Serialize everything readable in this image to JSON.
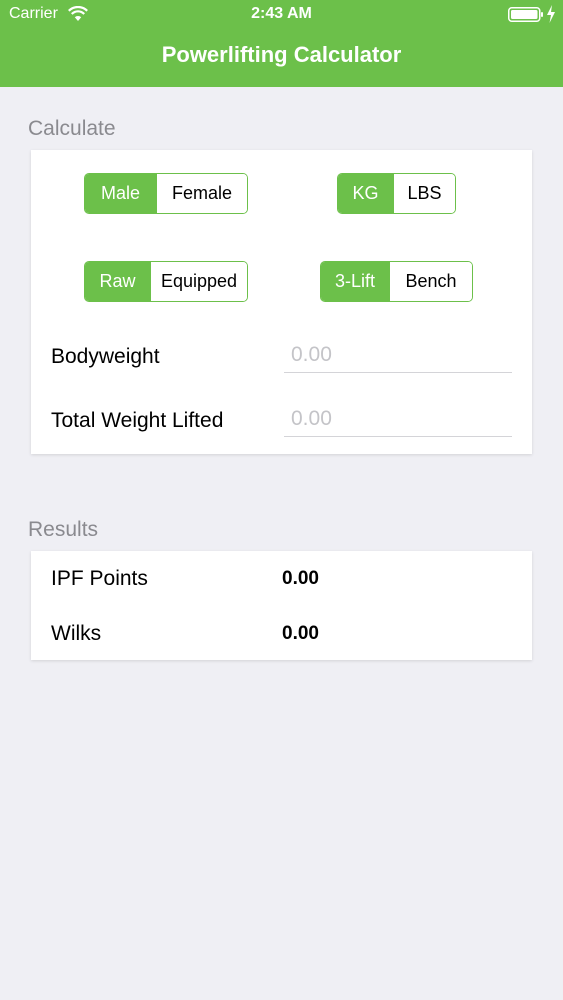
{
  "status_bar": {
    "carrier": "Carrier",
    "time": "2:43 AM"
  },
  "nav": {
    "title": "Powerlifting Calculator"
  },
  "calculate": {
    "header": "Calculate",
    "sex": {
      "options": [
        "Male",
        "Female"
      ],
      "selected": "Male"
    },
    "unit": {
      "options": [
        "KG",
        "LBS"
      ],
      "selected": "KG"
    },
    "equipment": {
      "options": [
        "Raw",
        "Equipped"
      ],
      "selected": "Raw"
    },
    "event": {
      "options": [
        "3-Lift",
        "Bench"
      ],
      "selected": "3-Lift"
    },
    "bodyweight": {
      "label": "Bodyweight",
      "placeholder": "0.00"
    },
    "total": {
      "label": "Total Weight Lifted",
      "placeholder": "0.00"
    }
  },
  "results": {
    "header": "Results",
    "ipf": {
      "label": "IPF Points",
      "value": "0.00"
    },
    "wilks": {
      "label": "Wilks",
      "value": "0.00"
    }
  },
  "colors": {
    "accent": "#6cc04a",
    "background": "#efeff4",
    "header_text": "#8a8a8f",
    "placeholder": "#c4c4c8"
  },
  "icons": {
    "wifi": "wifi-icon",
    "battery": "battery-icon",
    "charging": "charging-bolt-icon"
  }
}
